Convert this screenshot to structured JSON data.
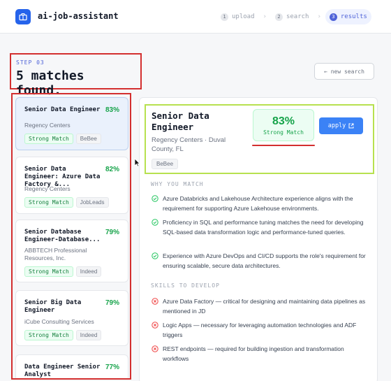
{
  "app": {
    "title": "ai-job-assistant",
    "logo_icon": "briefcase-icon"
  },
  "steps": [
    {
      "num": "1",
      "label": "upload"
    },
    {
      "num": "2",
      "label": "search"
    },
    {
      "num": "3",
      "label": "results"
    }
  ],
  "header": {
    "step_label": "STEP 03",
    "title": "5 matches found.",
    "new_search_label": "← new search"
  },
  "jobs": [
    {
      "title": "Senior Data Engineer",
      "company": "Regency Centers",
      "percent": "83%",
      "match": "Strong Match",
      "source": "BeBee"
    },
    {
      "title": "Senior Data Engineer: Azure Data Factory &...",
      "company": "Regency Centers",
      "percent": "82%",
      "match": "Strong Match",
      "source": "JobLeads"
    },
    {
      "title": "Senior Database Engineer-Database...",
      "company": "ABBTECH Professional Resources, Inc.",
      "percent": "79%",
      "match": "Strong Match",
      "source": "Indeed"
    },
    {
      "title": "Senior Big Data Engineer",
      "company": "iCube Consulting Services",
      "percent": "79%",
      "match": "Strong Match",
      "source": "Indeed"
    },
    {
      "title": "Data Engineer Senior Analyst",
      "company": "",
      "percent": "77%",
      "match": "",
      "source": ""
    }
  ],
  "detail": {
    "title": "Senior Data Engineer",
    "company": "Regency Centers · Duval County, FL",
    "source": "BeBee",
    "percent": "83%",
    "match_label": "Strong Match",
    "apply_label": "apply",
    "why_label": "WHY YOU MATCH",
    "reasons": [
      "Azure Databricks and Lakehouse Architecture experience aligns with the requirement for supporting Azure Lakehouse environments.",
      "Proficiency in SQL and performance tuning matches the need for developing SQL-based data transformation logic and performance-tuned queries.",
      "Experience with Azure DevOps and CI/CD supports the role's requirement for ensuring scalable, secure data architectures."
    ],
    "skills_label": "SKILLS TO DEVELOP",
    "skills": [
      "Azure Data Factory — critical for designing and maintaining data pipelines as mentioned in JD",
      "Logic Apps — necessary for leveraging automation technologies and ADF triggers",
      "REST endpoints — required for building ingestion and transformation workflows"
    ]
  },
  "colors": {
    "accent": "#4f63d8",
    "primary": "#3b82f6",
    "match_green": "#16a34a",
    "annotation_red": "#d32f2f",
    "annotation_green": "#b7e14f"
  }
}
